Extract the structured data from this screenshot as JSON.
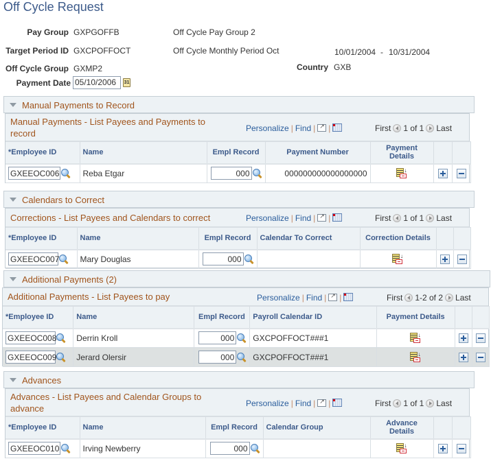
{
  "page": {
    "title": "Off Cycle Request"
  },
  "header": {
    "pay_group": {
      "label": "Pay Group",
      "value": "GXPGOFFB",
      "description": "Off Cycle Pay Group 2"
    },
    "target_period": {
      "label": "Target Period ID",
      "value": "GXCPOFFOCT",
      "description": "Off Cycle Monthly Period Oct",
      "start": "10/01/2004",
      "dash": "-",
      "end": "10/31/2004"
    },
    "off_cycle_group": {
      "label": "Off Cycle Group",
      "value": "GXMP2"
    },
    "country": {
      "label": "Country",
      "value": "GXB"
    },
    "payment_date": {
      "label": "Payment Date",
      "value": "05/10/2006",
      "calendar_glyph": "31"
    }
  },
  "nav_labels": {
    "personalize": "Personalize",
    "find": "Find",
    "sep": "|",
    "first": "First",
    "last": "Last"
  },
  "sections": {
    "manual": {
      "header": "Manual Payments to Record",
      "grid_title": "Manual Payments - List Payees and Payments to record",
      "range": "1 of 1",
      "columns": [
        "*Employee ID",
        "Name",
        "Empl Record",
        "Payment Number",
        "Payment Details"
      ],
      "rows": [
        {
          "employee_id": "GXEEOC006",
          "name": "Reba Etgar",
          "empl_record": "000",
          "payment_number": "000000000000000000"
        }
      ]
    },
    "calendars": {
      "header": "Calendars to Correct",
      "grid_title": "Corrections - List Payees and Calendars to correct",
      "range": "1 of 1",
      "columns": [
        "*Employee ID",
        "Name",
        "Empl Record",
        "Calendar To Correct",
        "Correction Details"
      ],
      "rows": [
        {
          "employee_id": "GXEEOC007",
          "name": "Mary Douglas",
          "empl_record": "000",
          "calendar": ""
        }
      ]
    },
    "additional": {
      "header": "Additional Payments (2)",
      "grid_title": "Additional Payments - List Payees to pay",
      "range": "1-2 of 2",
      "columns": [
        "*Employee ID",
        "Name",
        "Empl Record",
        "Payroll Calendar ID",
        "Payment Details"
      ],
      "rows": [
        {
          "employee_id": "GXEEOC008",
          "name": "Derrin Kroll",
          "empl_record": "000",
          "calendar_id": "GXCPOFFOCT###1"
        },
        {
          "employee_id": "GXEEOC009",
          "name": "Jerard Olersir",
          "empl_record": "000",
          "calendar_id": "GXCPOFFOCT###1"
        }
      ]
    },
    "advances": {
      "header": "Advances",
      "grid_title": "Advances - List Payees and Calendar Groups to advance",
      "range": "1 of 1",
      "columns": [
        "*Employee ID",
        "Name",
        "Empl Record",
        "Calendar Group",
        "Advance Details"
      ],
      "rows": [
        {
          "employee_id": "GXEEOC010",
          "name": "Irving Newberry",
          "empl_record": "000",
          "calendar_group": ""
        }
      ]
    }
  }
}
